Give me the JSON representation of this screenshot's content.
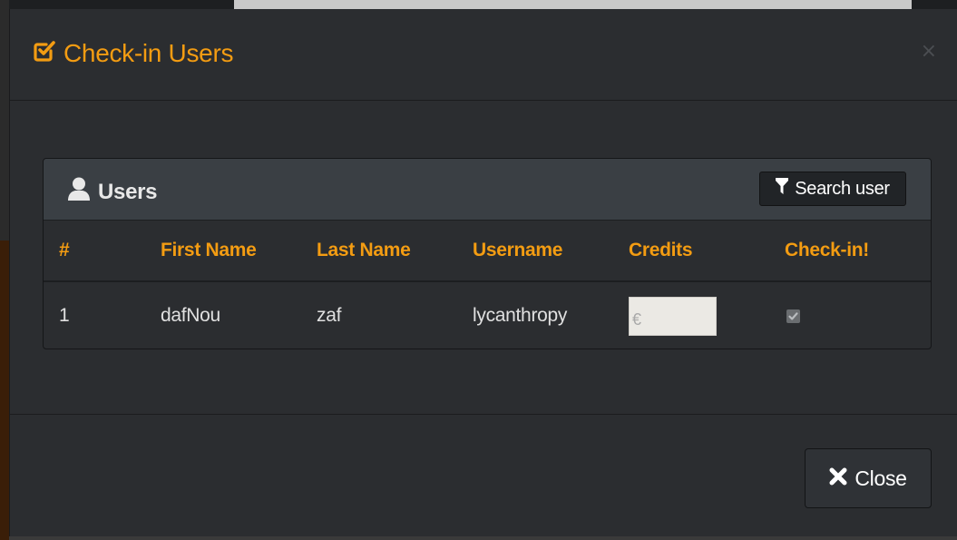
{
  "modal": {
    "title": "Check-in Users",
    "title_icon": "check-square-icon",
    "close_x": "×",
    "accent_color": "#f39c12"
  },
  "panel": {
    "title": "Users",
    "title_icon": "user-icon",
    "search_button_label": "Search user",
    "search_button_icon": "filter-icon"
  },
  "table": {
    "columns": [
      "#",
      "First Name",
      "Last Name",
      "Username",
      "Credits",
      "Check-in!"
    ],
    "rows": [
      {
        "index": "1",
        "first_name": "dafNou",
        "last_name": "zaf",
        "username": "lycanthropy",
        "credits_value": "",
        "credits_placeholder": "€",
        "checked_in": true
      }
    ]
  },
  "footer": {
    "close_label": "Close",
    "close_icon": "close-icon"
  }
}
